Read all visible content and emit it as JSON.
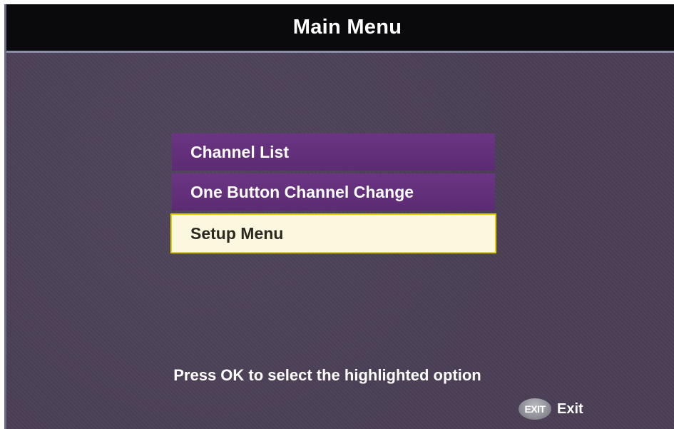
{
  "header": {
    "title": "Main Menu"
  },
  "menu": {
    "items": [
      {
        "label": "Channel List",
        "selected": false
      },
      {
        "label": "One Button Channel Change",
        "selected": false
      },
      {
        "label": "Setup Menu",
        "selected": true
      }
    ]
  },
  "footer": {
    "hint": "Press OK to select the highlighted option",
    "exit_icon_text": "EXIT",
    "exit_label": "Exit"
  },
  "colors": {
    "background": "#4a3f56",
    "menu_item": "#62307a",
    "menu_item_selected": "#fbf8df",
    "selection_border": "#e6d200"
  }
}
